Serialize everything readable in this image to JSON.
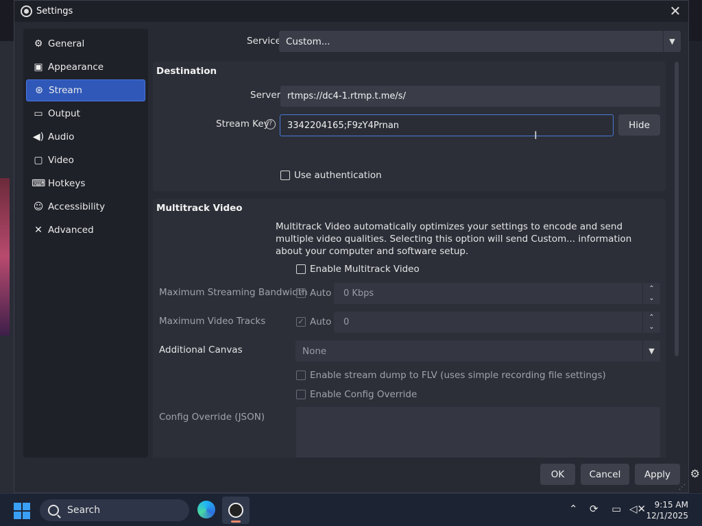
{
  "window": {
    "title": "Settings"
  },
  "sidebar": {
    "items": [
      {
        "label": "General",
        "icon": "gear-icon"
      },
      {
        "label": "Appearance",
        "icon": "palette-icon"
      },
      {
        "label": "Stream",
        "icon": "antenna-icon",
        "active": true
      },
      {
        "label": "Output",
        "icon": "monitor-output-icon"
      },
      {
        "label": "Audio",
        "icon": "speaker-icon"
      },
      {
        "label": "Video",
        "icon": "screen-icon"
      },
      {
        "label": "Hotkeys",
        "icon": "keyboard-icon"
      },
      {
        "label": "Accessibility",
        "icon": "accessibility-icon"
      },
      {
        "label": "Advanced",
        "icon": "wrench-icon"
      }
    ]
  },
  "service": {
    "label": "Service",
    "value": "Custom..."
  },
  "destination": {
    "title": "Destination",
    "server_label": "Server",
    "server_value": "rtmps://dc4-1.rtmp.t.me/s/",
    "stream_key_label": "Stream Key",
    "stream_key_value": "3342204165;F9zY4Prnan",
    "hide_label": "Hide",
    "use_auth_label": "Use authentication"
  },
  "multitrack": {
    "title": "Multitrack Video",
    "description": "Multitrack Video automatically optimizes your settings to encode and send multiple video qualities. Selecting this option will send Custom... information about your computer and software setup.",
    "enable_label": "Enable Multitrack Video",
    "max_bandwidth_label": "Maximum Streaming Bandwidth",
    "max_bandwidth_auto": "Auto",
    "max_bandwidth_value": "0 Kbps",
    "max_tracks_label": "Maximum Video Tracks",
    "max_tracks_auto": "Auto",
    "max_tracks_value": "0",
    "additional_canvas_label": "Additional Canvas",
    "additional_canvas_value": "None",
    "stream_dump_label": "Enable stream dump to FLV (uses simple recording file settings)",
    "config_override_label": "Enable Config Override",
    "config_json_label": "Config Override (JSON)"
  },
  "footer": {
    "ok": "OK",
    "cancel": "Cancel",
    "apply": "Apply"
  },
  "taskbar": {
    "search_placeholder": "Search",
    "time": "9:15 AM",
    "date": "12/1/2025"
  }
}
